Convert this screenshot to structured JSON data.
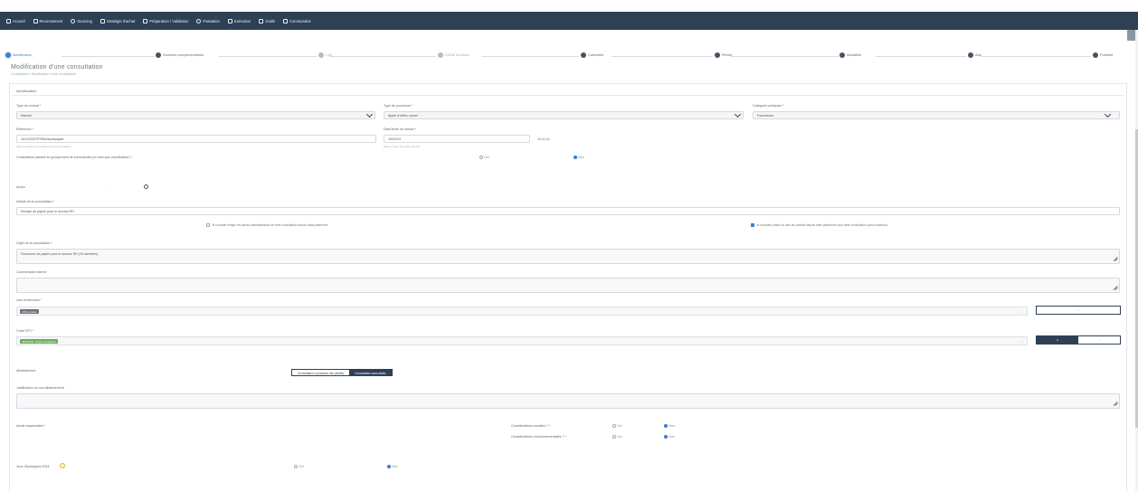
{
  "nav": {
    "items": [
      {
        "icon": "home-icon",
        "label": "Accueil"
      },
      {
        "icon": "list-icon",
        "label": "Recensement"
      },
      {
        "icon": "search-icon",
        "label": "Sourcing"
      },
      {
        "icon": "grid-icon",
        "label": "Stratégie d'achat"
      },
      {
        "icon": "pen-icon",
        "label": "Préparation / Validation"
      },
      {
        "icon": "info-icon",
        "label": "Passation"
      },
      {
        "icon": "calendar-icon",
        "label": "Exécution"
      },
      {
        "icon": "wrench-icon",
        "label": "Outils"
      },
      {
        "icon": "calendar-icon",
        "label": "Commandes"
      }
    ]
  },
  "stepper": {
    "steps": [
      {
        "label": "Identification",
        "state": "active"
      },
      {
        "label": "Données complémentaires",
        "state": "done"
      },
      {
        "label": "Lots",
        "state": "dim"
      },
      {
        "label": "DUME Acheteur",
        "state": "dim"
      },
      {
        "label": "Calendrier",
        "state": "done"
      },
      {
        "label": "Pièces",
        "state": "done"
      },
      {
        "label": "Modalités",
        "state": "done"
      },
      {
        "label": "Avis",
        "state": "done"
      },
      {
        "label": "Publicité",
        "state": "done"
      }
    ]
  },
  "page": {
    "title": "Modification d'une consultation",
    "breadcrumb_1": "Consultation",
    "breadcrumb_2": "Modification d'une consultation"
  },
  "form": {
    "section_title": "Identification",
    "type_contrat": {
      "label": "Type de contrat *",
      "value": "Marché"
    },
    "type_procedure": {
      "label": "Type de procédure *",
      "value": "Appel d'offres ouvert"
    },
    "categorie": {
      "label": "Catégorie principale *",
      "value": "Fournitures"
    },
    "reference": {
      "label": "Référence *",
      "value": "1A1202327P2Remiselepapier",
      "hint": "Aide à la saisie de la référence de la consultation"
    },
    "date_limite": {
      "label": "Date limite de remise *",
      "value": "15/02/24",
      "time": "10:41:41",
      "hint": "Date et heure de remise des plis"
    },
    "groupement": {
      "label": "Consultation passée en groupement de commandes (en tant que coordinateur) *",
      "oui": "Oui",
      "non": "Non",
      "selected": "non"
    },
    "acces": {
      "label": "Accès"
    },
    "intitule": {
      "label": "Intitulé de la consultation *",
      "value": "Remise de papier pour le service RH"
    },
    "chk_left": "Je souhaite rédiger les pièces administratives de cette consultation depuis cette plateforme",
    "chk_right": "Je souhaite publier un avis de publicité depuis cette plateforme pour cette consultation (sans rédaction)",
    "objet": {
      "label": "Objet de la consultation *",
      "value": "Fourniture de papier pour le service RH (10 ramettes)"
    },
    "commentaire": {
      "label": "Commentaire interne",
      "value": ""
    },
    "lieu": {
      "label": "Lieu d'exécution *",
      "tag": "(00) Lorraine"
    },
    "cpv": {
      "label": "Code CPV *",
      "tag": "30197630 - Papier à imprimer"
    },
    "allotissement": {
      "label": "Allotissement",
      "opt1": "Consultation à plusieurs lots (allotie)",
      "opt2": "Consultation sans allotis"
    },
    "justification": {
      "label": "Justification du non allotissement",
      "value": ""
    },
    "achat_responsable": {
      "label": "Achat responsable *"
    },
    "clause_sociale": {
      "label": "Considérations sociales ? *",
      "oui": "Oui",
      "non": "Non",
      "selected": "non"
    },
    "clause_env": {
      "label": "Considérations environnementales ? *",
      "oui": "Oui",
      "non": "Non",
      "selected": "non"
    },
    "jeux": {
      "label": "Jeux Olympiques 2024",
      "oui": "Oui",
      "non": "Non",
      "selected": "non"
    }
  }
}
